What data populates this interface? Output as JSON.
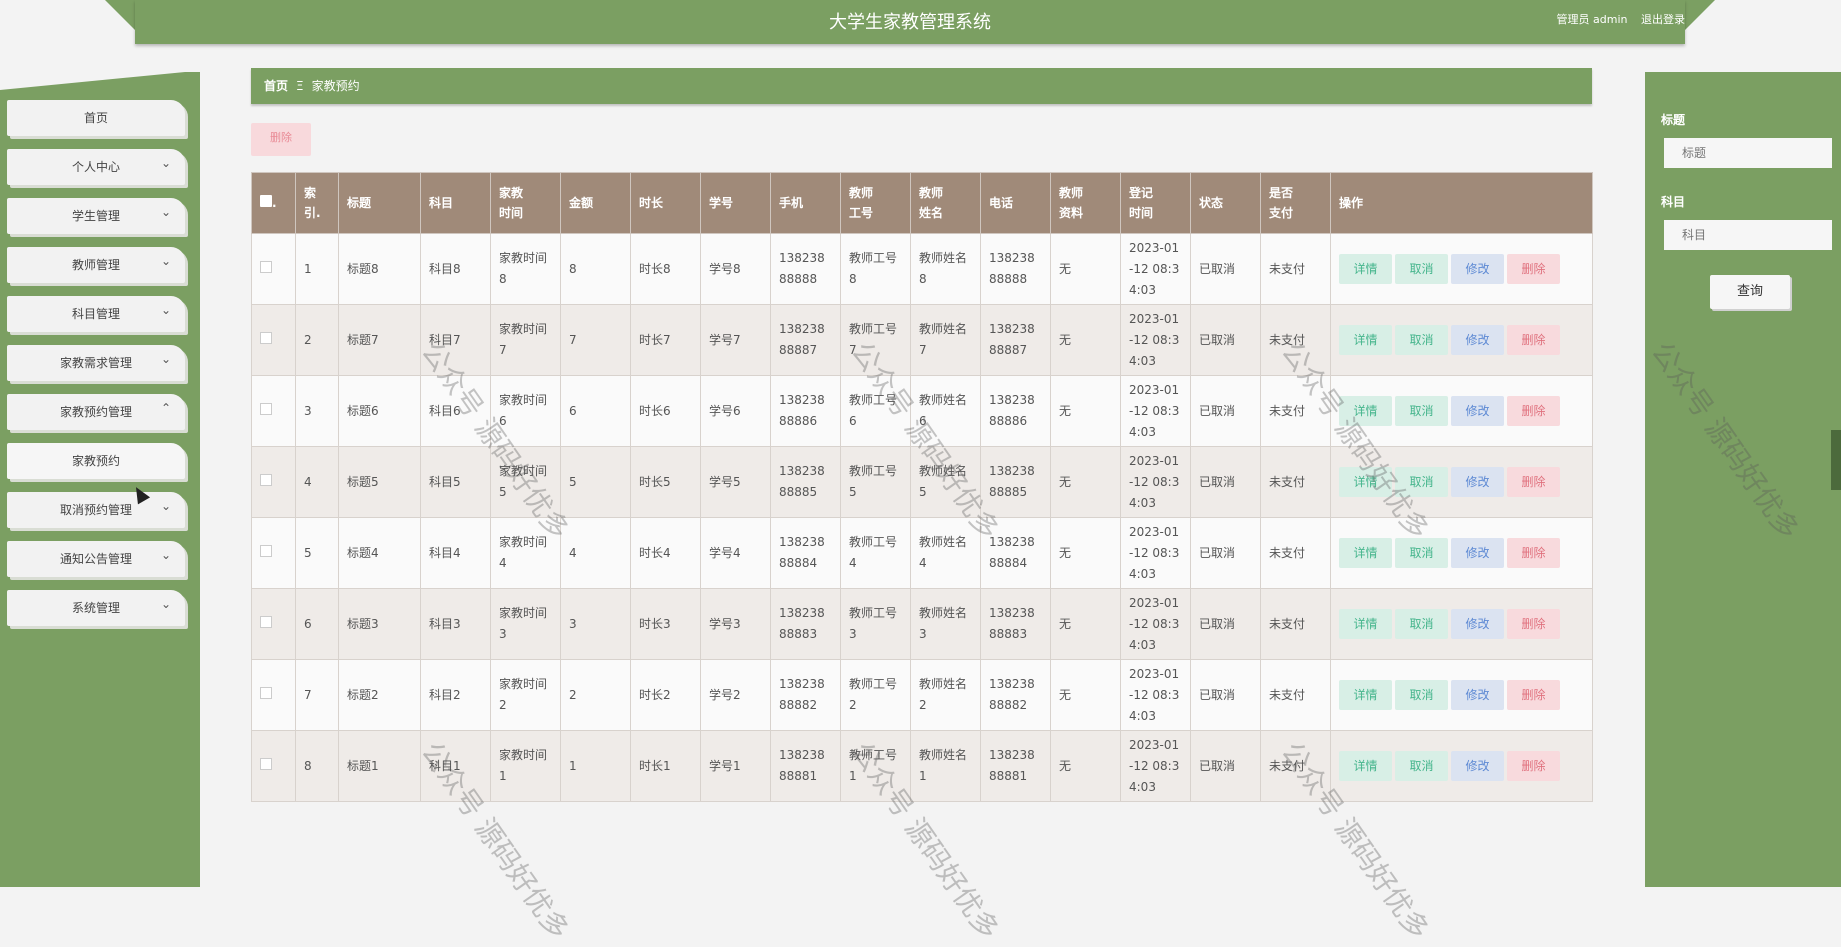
{
  "header": {
    "title": "大学生家教管理系统",
    "role_user": "管理员 admin",
    "logout": "退出登录"
  },
  "sidebar": {
    "items": [
      {
        "label": "首页"
      },
      {
        "label": "个人中心"
      },
      {
        "label": "学生管理"
      },
      {
        "label": "教师管理"
      },
      {
        "label": "科目管理"
      },
      {
        "label": "家教需求管理"
      },
      {
        "label": "家教预约管理"
      },
      {
        "label": "家教预约"
      },
      {
        "label": "取消预约管理"
      },
      {
        "label": "通知公告管理"
      },
      {
        "label": "系统管理"
      }
    ]
  },
  "breadcrumb": {
    "home": "首页",
    "sep": "Ξ",
    "current": "家教预约"
  },
  "toolbar": {
    "delete_label": "删除"
  },
  "search": {
    "title_label": "标题",
    "title_placeholder": "标题",
    "subject_label": "科目",
    "subject_placeholder": "科目",
    "query_label": "查询"
  },
  "table": {
    "columns": [
      "索引",
      "标题",
      "科目",
      "家教时间",
      "金额",
      "时长",
      "学号",
      "手机",
      "教师工号",
      "教师姓名",
      "电话",
      "教师资料",
      "登记时间",
      "状态",
      "是否支付",
      "操作"
    ],
    "header_display": {
      "index": "索\n引.",
      "title": "标题",
      "subject": "科目",
      "time": "家教\n时间",
      "amount": "金额",
      "duration": "时长",
      "student_no": "学号",
      "phone": "手机",
      "teacher_no": "教师\n工号",
      "teacher_name": "教师\n姓名",
      "tel": "电话",
      "teacher_info": "教师\n资料",
      "reg_time": "登记\n时间",
      "status": "状态",
      "paid": "是否\n支付",
      "ops": "操作"
    },
    "actions": {
      "detail": "详情",
      "cancel": "取消",
      "edit": "修改",
      "delete": "删除"
    },
    "rows": [
      {
        "index": "1",
        "title": "标题8",
        "subject": "科目8",
        "time": "家教时间8",
        "amount": "8",
        "duration": "时长8",
        "student_no": "学号8",
        "phone": "13823888888",
        "teacher_no": "教师工号8",
        "teacher_name": "教师姓名8",
        "tel": "13823888888",
        "teacher_info": "无",
        "reg_time": "2023-01-12 08:34:03",
        "status": "已取消",
        "paid": "未支付"
      },
      {
        "index": "2",
        "title": "标题7",
        "subject": "科目7",
        "time": "家教时间7",
        "amount": "7",
        "duration": "时长7",
        "student_no": "学号7",
        "phone": "13823888887",
        "teacher_no": "教师工号7",
        "teacher_name": "教师姓名7",
        "tel": "13823888887",
        "teacher_info": "无",
        "reg_time": "2023-01-12 08:34:03",
        "status": "已取消",
        "paid": "未支付"
      },
      {
        "index": "3",
        "title": "标题6",
        "subject": "科目6",
        "time": "家教时间6",
        "amount": "6",
        "duration": "时长6",
        "student_no": "学号6",
        "phone": "13823888886",
        "teacher_no": "教师工号6",
        "teacher_name": "教师姓名6",
        "tel": "13823888886",
        "teacher_info": "无",
        "reg_time": "2023-01-12 08:34:03",
        "status": "已取消",
        "paid": "未支付"
      },
      {
        "index": "4",
        "title": "标题5",
        "subject": "科目5",
        "time": "家教时间5",
        "amount": "5",
        "duration": "时长5",
        "student_no": "学号5",
        "phone": "13823888885",
        "teacher_no": "教师工号5",
        "teacher_name": "教师姓名5",
        "tel": "13823888885",
        "teacher_info": "无",
        "reg_time": "2023-01-12 08:34:03",
        "status": "已取消",
        "paid": "未支付"
      },
      {
        "index": "5",
        "title": "标题4",
        "subject": "科目4",
        "time": "家教时间4",
        "amount": "4",
        "duration": "时长4",
        "student_no": "学号4",
        "phone": "13823888884",
        "teacher_no": "教师工号4",
        "teacher_name": "教师姓名4",
        "tel": "13823888884",
        "teacher_info": "无",
        "reg_time": "2023-01-12 08:34:03",
        "status": "已取消",
        "paid": "未支付"
      },
      {
        "index": "6",
        "title": "标题3",
        "subject": "科目3",
        "time": "家教时间3",
        "amount": "3",
        "duration": "时长3",
        "student_no": "学号3",
        "phone": "13823888883",
        "teacher_no": "教师工号3",
        "teacher_name": "教师姓名3",
        "tel": "13823888883",
        "teacher_info": "无",
        "reg_time": "2023-01-12 08:34:03",
        "status": "已取消",
        "paid": "未支付"
      },
      {
        "index": "7",
        "title": "标题2",
        "subject": "科目2",
        "time": "家教时间2",
        "amount": "2",
        "duration": "时长2",
        "student_no": "学号2",
        "phone": "13823888882",
        "teacher_no": "教师工号2",
        "teacher_name": "教师姓名2",
        "tel": "13823888882",
        "teacher_info": "无",
        "reg_time": "2023-01-12 08:34:03",
        "status": "已取消",
        "paid": "未支付"
      },
      {
        "index": "8",
        "title": "标题1",
        "subject": "科目1",
        "time": "家教时间1",
        "amount": "1",
        "duration": "时长1",
        "student_no": "学号1",
        "phone": "13823888881",
        "teacher_no": "教师工号1",
        "teacher_name": "教师姓名1",
        "tel": "13823888881",
        "teacher_info": "无",
        "reg_time": "2023-01-12 08:34:03",
        "status": "已取消",
        "paid": "未支付"
      }
    ]
  },
  "watermark": "公众号 源码好优多",
  "colors": {
    "primary": "#7b9f62",
    "table_header": "#a08a79",
    "danger_bg": "#f8dadd",
    "success_bg": "#d8efe6",
    "edit_bg": "#dbe3f1"
  }
}
